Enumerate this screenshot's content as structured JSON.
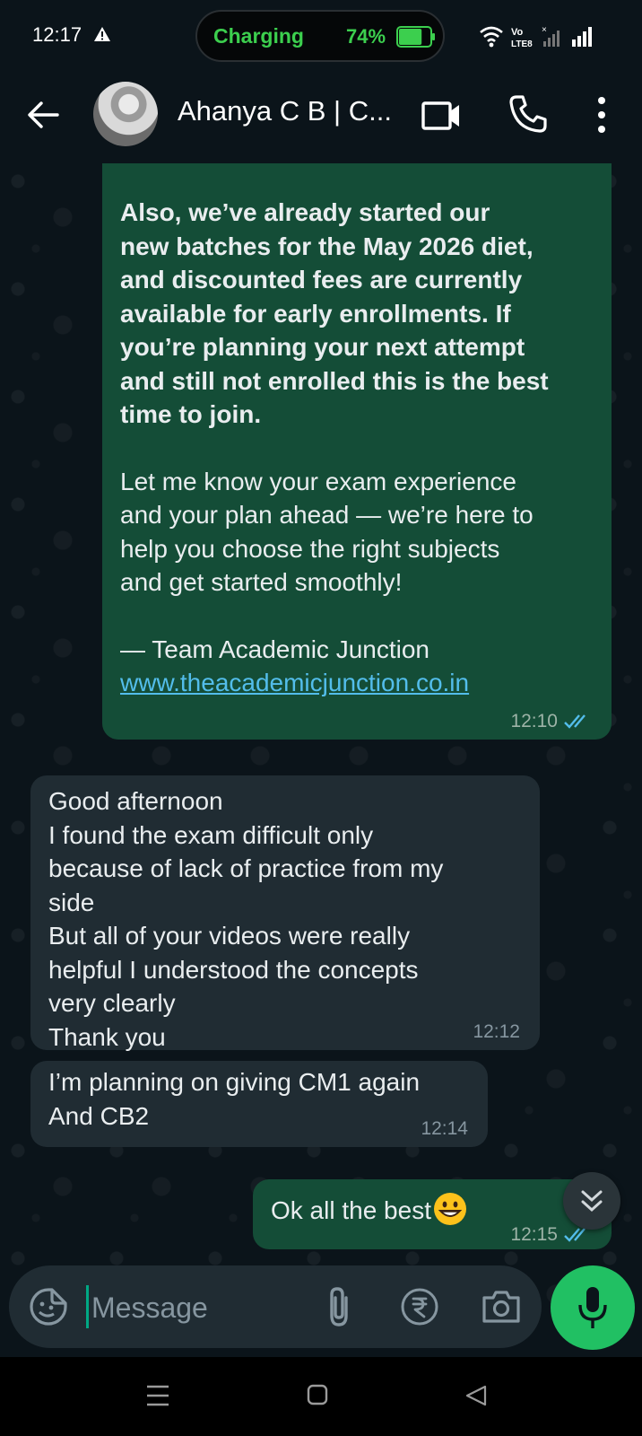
{
  "status_bar": {
    "time": "12:17",
    "charging_label": "Charging",
    "battery_percent": "74%",
    "battery_level": 0.74,
    "network_label_top": "Vo",
    "network_label_bottom": "LTE8",
    "accent_color": "#3ccf4e"
  },
  "header": {
    "contact_name": "Ahanya C B | C...",
    "icons": [
      "back-arrow-icon",
      "video-call-icon",
      "phone-icon",
      "more-vertical-icon"
    ]
  },
  "messages": [
    {
      "direction": "outgoing",
      "bold_text": "Also, we’ve already started our\nnew batches for the May 2026 diet,\nand discounted fees are currently\navailable for early enrollments. If\nyou’re planning your next attempt\nand still not enrolled  this is the best\ntime to join.",
      "text": "Let me know your exam experience\nand your plan ahead — we’re here to\nhelp you choose the right subjects\nand get started smoothly!",
      "signature": "— Team Academic Junction",
      "link": "www.theacademicjunction.co.in",
      "time": "12:10",
      "status": "read"
    },
    {
      "direction": "incoming",
      "text": "Good afternoon\nI found the exam difficult only\nbecause of lack of practice from my\nside\nBut all of your videos were really\nhelpful I understood the concepts\nvery clearly\nThank you",
      "time": "12:12"
    },
    {
      "direction": "incoming",
      "text": "I’m planning on giving CM1 again\nAnd CB2",
      "time": "12:14"
    },
    {
      "direction": "outgoing",
      "text": "Ok all the best",
      "emoji": "grinning-face",
      "time": "12:15",
      "status": "read"
    }
  ],
  "composer": {
    "placeholder": "Message",
    "icons": [
      "sticker-icon",
      "attach-icon",
      "rupee-icon",
      "camera-icon",
      "mic-icon"
    ]
  },
  "colors": {
    "background": "#0b141a",
    "outgoing_bubble": "#144d37",
    "incoming_bubble": "#202c33",
    "link": "#53bdeb",
    "read_ticks": "#53bdeb",
    "mic_button": "#21c063"
  }
}
